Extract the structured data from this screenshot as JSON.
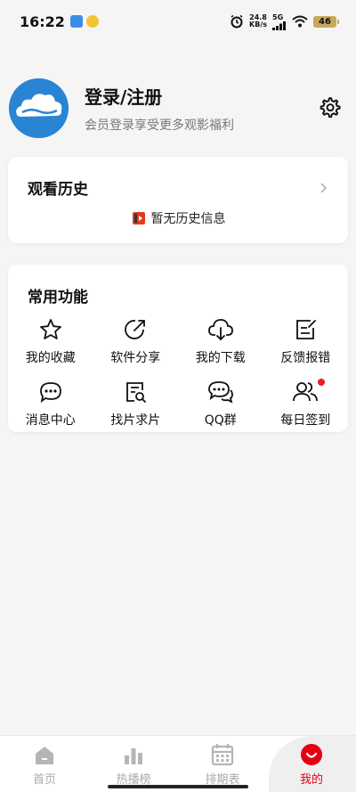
{
  "status": {
    "time": "16:22",
    "speed_value": "24.8",
    "speed_unit": "KB/s",
    "network": "5G",
    "battery": "46"
  },
  "profile": {
    "title": "登录/注册",
    "subtitle": "会员登录享受更多观影福利"
  },
  "history": {
    "title": "观看历史",
    "empty_text": "暂无历史信息"
  },
  "functions": {
    "title": "常用功能",
    "items": [
      {
        "label": "我的收藏",
        "icon": "star-icon"
      },
      {
        "label": "软件分享",
        "icon": "share-icon"
      },
      {
        "label": "我的下载",
        "icon": "cloud-download-icon"
      },
      {
        "label": "反馈报错",
        "icon": "feedback-edit-icon"
      },
      {
        "label": "消息中心",
        "icon": "message-icon"
      },
      {
        "label": "找片求片",
        "icon": "search-document-icon"
      },
      {
        "label": "QQ群",
        "icon": "chat-bubbles-icon"
      },
      {
        "label": "每日签到",
        "icon": "users-icon"
      }
    ]
  },
  "nav": {
    "items": [
      {
        "label": "首页",
        "icon": "home-icon"
      },
      {
        "label": "热播榜",
        "icon": "bar-chart-icon"
      },
      {
        "label": "排期表",
        "icon": "calendar-icon"
      },
      {
        "label": "我的",
        "icon": "smile-icon"
      }
    ],
    "active_index": 3
  },
  "colors": {
    "accent": "#e60012",
    "avatar_bg": "#2a84d4",
    "background": "#f5f5f5"
  }
}
